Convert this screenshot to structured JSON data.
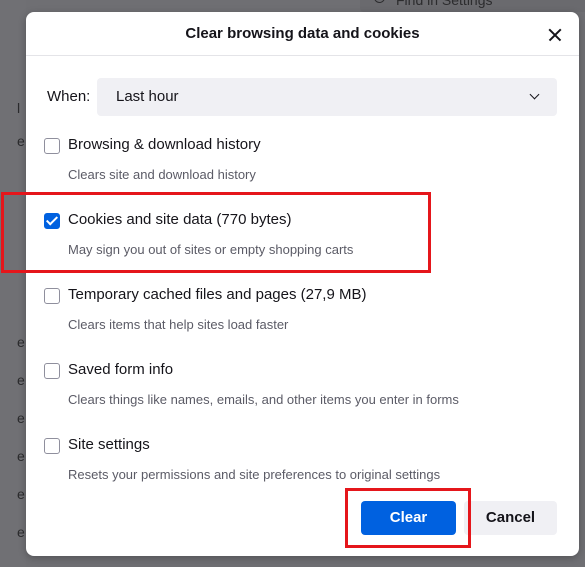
{
  "background": {
    "search_placeholder": "Find in Settings",
    "left_glyphs": [
      "l",
      "e",
      "e",
      "e",
      "e",
      "e",
      "e",
      "e"
    ]
  },
  "dialog": {
    "title": "Clear browsing data and cookies",
    "when_label": "When:",
    "when_value": "Last hour",
    "options": [
      {
        "label": "Browsing & download history",
        "description": "Clears site and download history",
        "checked": false
      },
      {
        "label": "Cookies and site data (770 bytes)",
        "description": "May sign you out of sites or empty shopping carts",
        "checked": true
      },
      {
        "label": "Temporary cached files and pages (27,9 MB)",
        "description": "Clears items that help sites load faster",
        "checked": false
      },
      {
        "label": "Saved form info",
        "description": "Clears things like names, emails, and other items you enter in forms",
        "checked": false
      },
      {
        "label": "Site settings",
        "description": "Resets your permissions and site preferences to original settings",
        "checked": false
      }
    ],
    "clear_label": "Clear",
    "cancel_label": "Cancel"
  },
  "colors": {
    "accent": "#0061e0",
    "highlight": "#e5161b"
  }
}
